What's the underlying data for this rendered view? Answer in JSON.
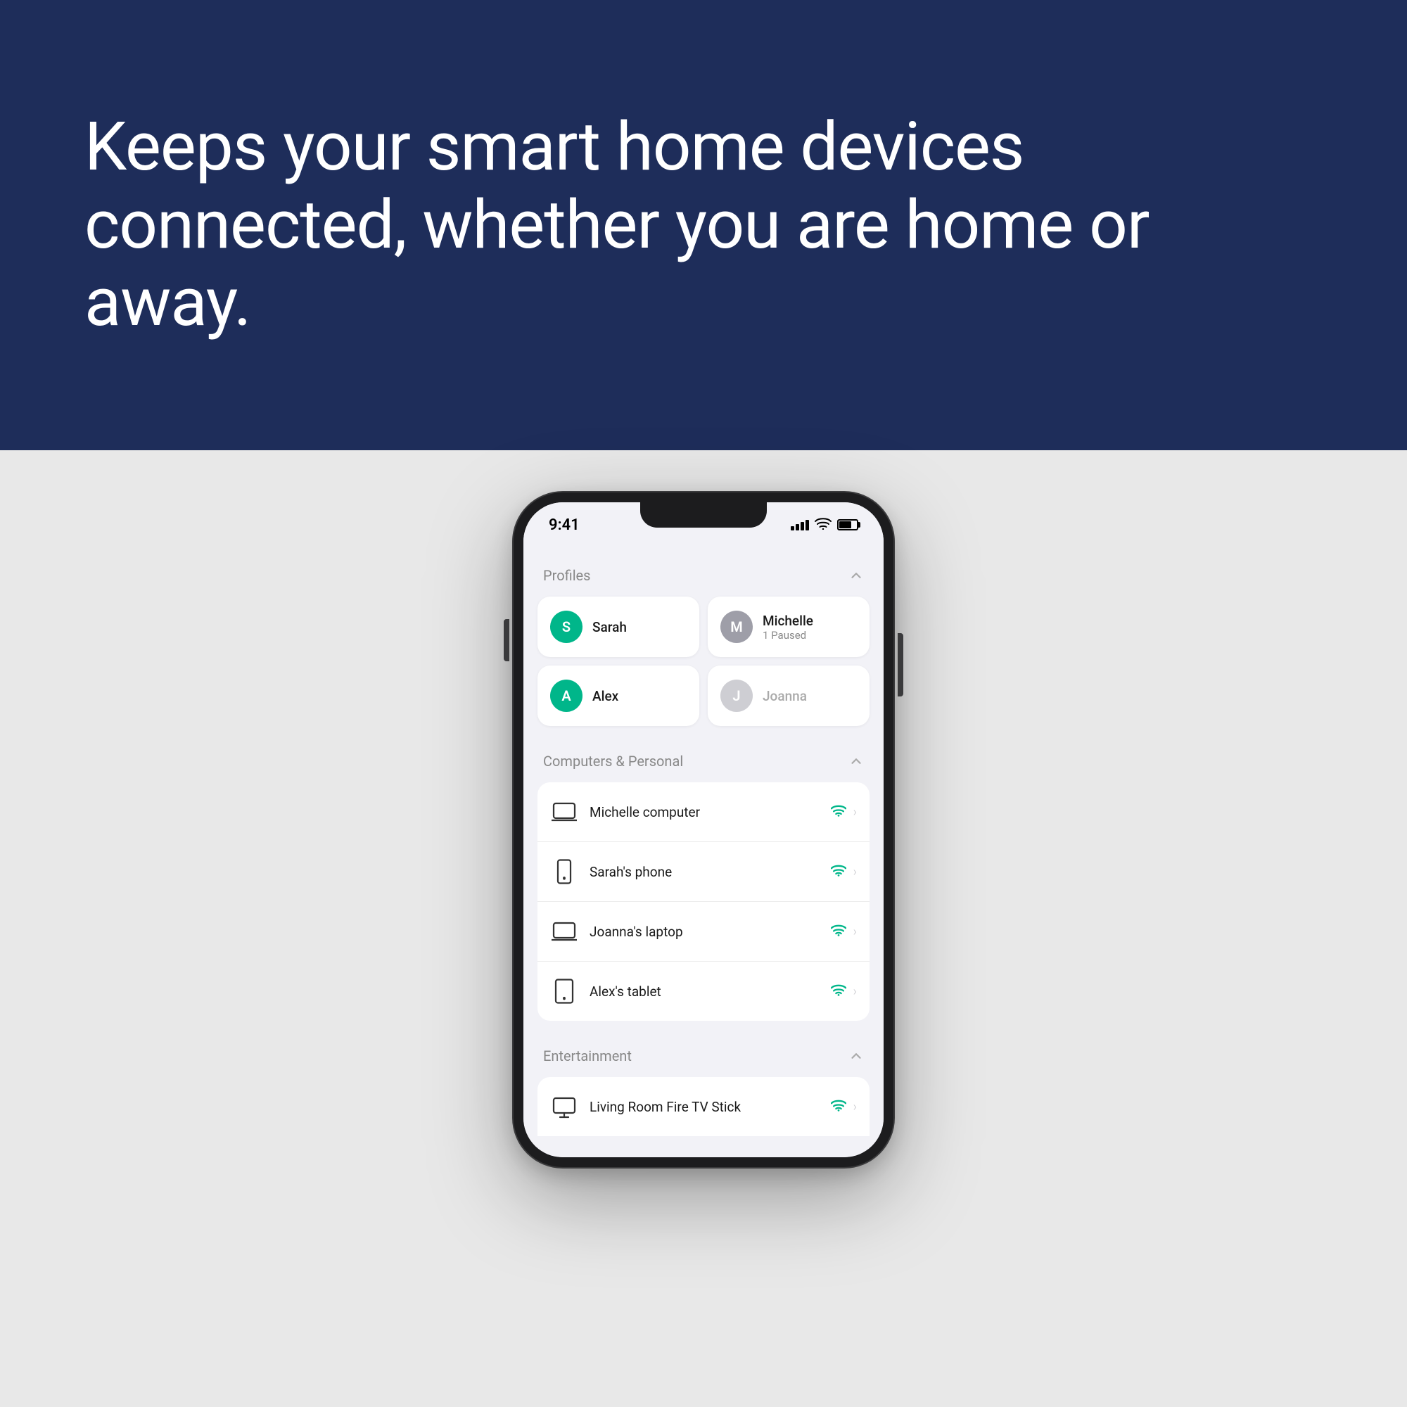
{
  "hero": {
    "text": "Keeps your smart home devices connected, whether you are home or away."
  },
  "phone": {
    "statusBar": {
      "time": "9:41",
      "signalBars": [
        4,
        6,
        8,
        10,
        12
      ],
      "batteryLevel": "70%"
    },
    "profiles": {
      "sectionTitle": "Profiles",
      "items": [
        {
          "id": "sarah",
          "initial": "S",
          "name": "Sarah",
          "subtitle": "",
          "avatarColor": "green",
          "active": true
        },
        {
          "id": "michelle",
          "initial": "M",
          "name": "Michelle",
          "subtitle": "1 Paused",
          "avatarColor": "gray",
          "active": true
        },
        {
          "id": "alex",
          "initial": "A",
          "name": "Alex",
          "subtitle": "",
          "avatarColor": "green",
          "active": true
        },
        {
          "id": "joanna",
          "initial": "J",
          "name": "Joanna",
          "subtitle": "",
          "avatarColor": "gray",
          "active": false
        }
      ]
    },
    "computersSection": {
      "sectionTitle": "Computers & Personal",
      "devices": [
        {
          "id": "michelle-computer",
          "name": "Michelle computer",
          "iconType": "laptop",
          "connected": true
        },
        {
          "id": "sarahs-phone",
          "name": "Sarah's phone",
          "iconType": "phone",
          "connected": true
        },
        {
          "id": "joannas-laptop",
          "name": "Joanna's laptop",
          "iconType": "laptop",
          "connected": true
        },
        {
          "id": "alexs-tablet",
          "name": "Alex's tablet",
          "iconType": "tablet",
          "connected": true
        }
      ]
    },
    "entertainmentSection": {
      "sectionTitle": "Entertainment",
      "devices": [
        {
          "id": "fire-tv-stick",
          "name": "Living Room Fire TV Stick",
          "iconType": "tv",
          "connected": true
        }
      ]
    }
  }
}
